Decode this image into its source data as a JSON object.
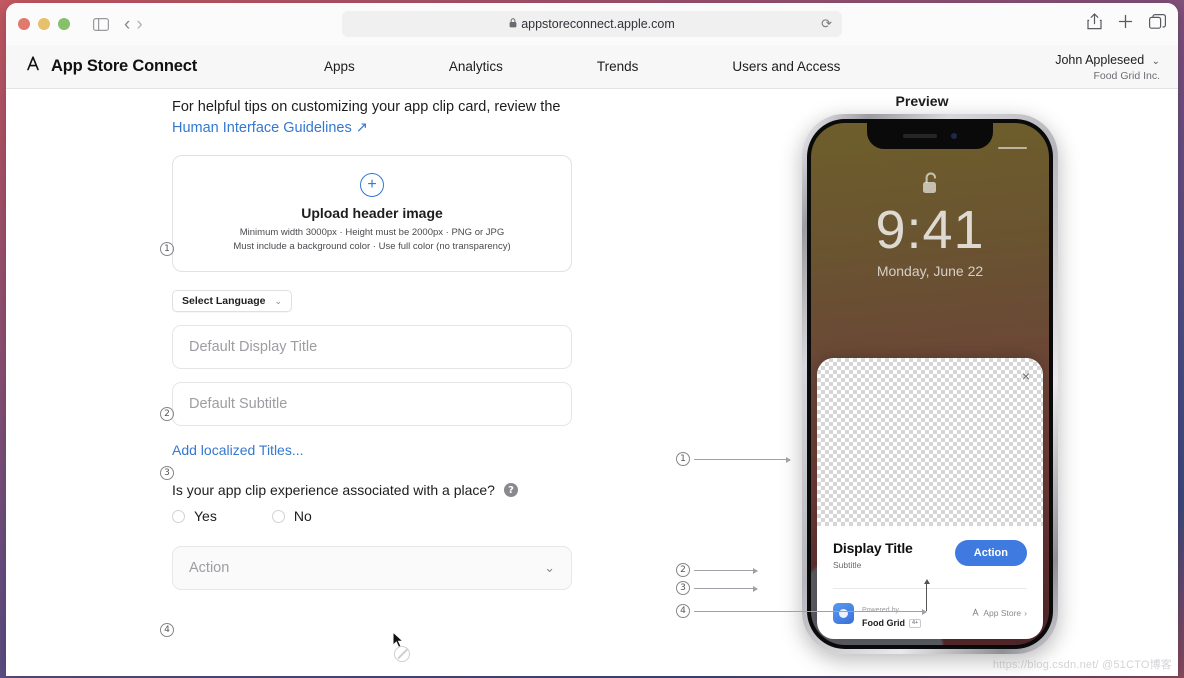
{
  "browser": {
    "address": "appstoreconnect.apple.com",
    "lock_icon": "lock-icon",
    "reload_icon": "reload-icon",
    "shield_icon": "privacy-shield-icon",
    "sidebar_icon": "sidebar-toggle-icon",
    "back_icon": "back-arrow-icon",
    "forward_icon": "forward-arrow-icon",
    "share_icon": "share-icon",
    "newtab_icon": "new-tab-icon",
    "tabs_icon": "tab-overview-icon",
    "traffic_lights": [
      "close",
      "minimize",
      "zoom"
    ]
  },
  "appheader": {
    "brand": "App Store Connect",
    "brand_icon": "app-store-connect-logo",
    "nav": [
      {
        "label": "Apps"
      },
      {
        "label": "Analytics"
      },
      {
        "label": "Trends"
      },
      {
        "label": "Users and Access"
      }
    ],
    "account": {
      "name": "John Appleseed",
      "org": "Food Grid Inc.",
      "chevron": "chevron-down-icon"
    }
  },
  "form": {
    "tip_text": "For helpful tips on customizing your app clip card, review the",
    "tip_link": "Human Interface Guidelines",
    "tip_link_glyph": "↗",
    "badges": [
      "1",
      "2",
      "3",
      "4"
    ],
    "dropzone": {
      "plus_glyph": "+",
      "title": "Upload header image",
      "line1": "Minimum width 3000px · Height must be 2000px · PNG or JPG",
      "line2": "Must include a background color · Use full color (no transparency)"
    },
    "language_select": {
      "label": "Select Language",
      "chevron": "chevron-down-icon"
    },
    "display_title_placeholder": "Default Display Title",
    "subtitle_placeholder": "Default Subtitle",
    "add_localized": "Add localized Titles...",
    "question": "Is your app clip experience associated with a place?",
    "help_glyph": "?",
    "radio_yes": "Yes",
    "radio_no": "No",
    "action_placeholder": "Action",
    "action_chevron": "chevron-down-icon"
  },
  "preview": {
    "title": "Preview",
    "phone": {
      "time": "9:41",
      "date": "Monday, June 22",
      "lock_icon": "unlocked-padlock-icon"
    },
    "clipcard": {
      "close_glyph": "×",
      "display_title": "Display Title",
      "subtitle": "Subtitle",
      "action_button": "Action",
      "powered_by": "Powered by",
      "app_name": "Food Grid",
      "age_rating": "4+",
      "store_label": "App Store",
      "store_chevron": "›"
    },
    "callouts": [
      "1",
      "2",
      "3",
      "4"
    ]
  },
  "colors": {
    "accent_blue": "#3478d1",
    "action_blue": "#3f7ae0",
    "text_primary": "#1d1d1f",
    "text_muted": "#6e6e73"
  },
  "watermark": "https://blog.csdn.net/ @51CTO博客"
}
